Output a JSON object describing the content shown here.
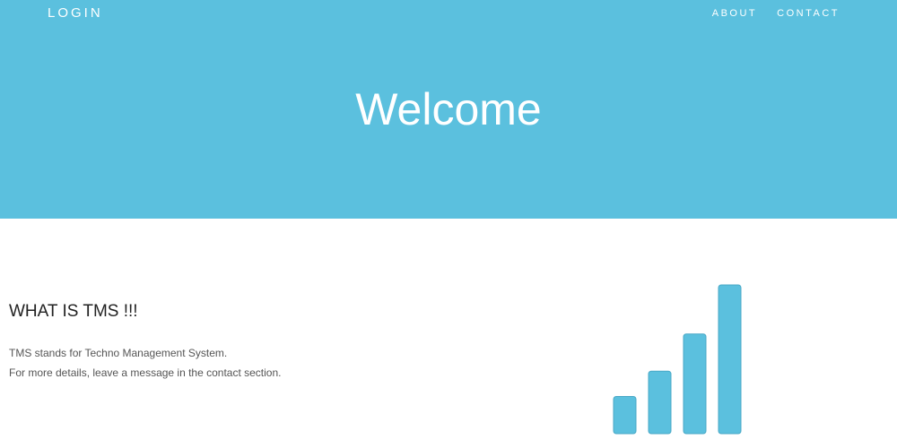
{
  "nav": {
    "brand": "LOGIN",
    "links": [
      "ABOUT",
      "CONTACT"
    ]
  },
  "hero": {
    "title": "Welcome"
  },
  "section": {
    "title": "WHAT IS TMS !!!",
    "description_lines": [
      "TMS stands for Techno Management System.",
      "For more details, leave a message in the contact section."
    ]
  },
  "icon": {
    "name": "bar-chart-icon",
    "color": "#5bc0de",
    "bar_levels": [
      0.25,
      0.42,
      0.67,
      1.0
    ]
  },
  "colors": {
    "hero_background": "#5bc0de",
    "heading": "#222222",
    "body_text": "#555555"
  }
}
